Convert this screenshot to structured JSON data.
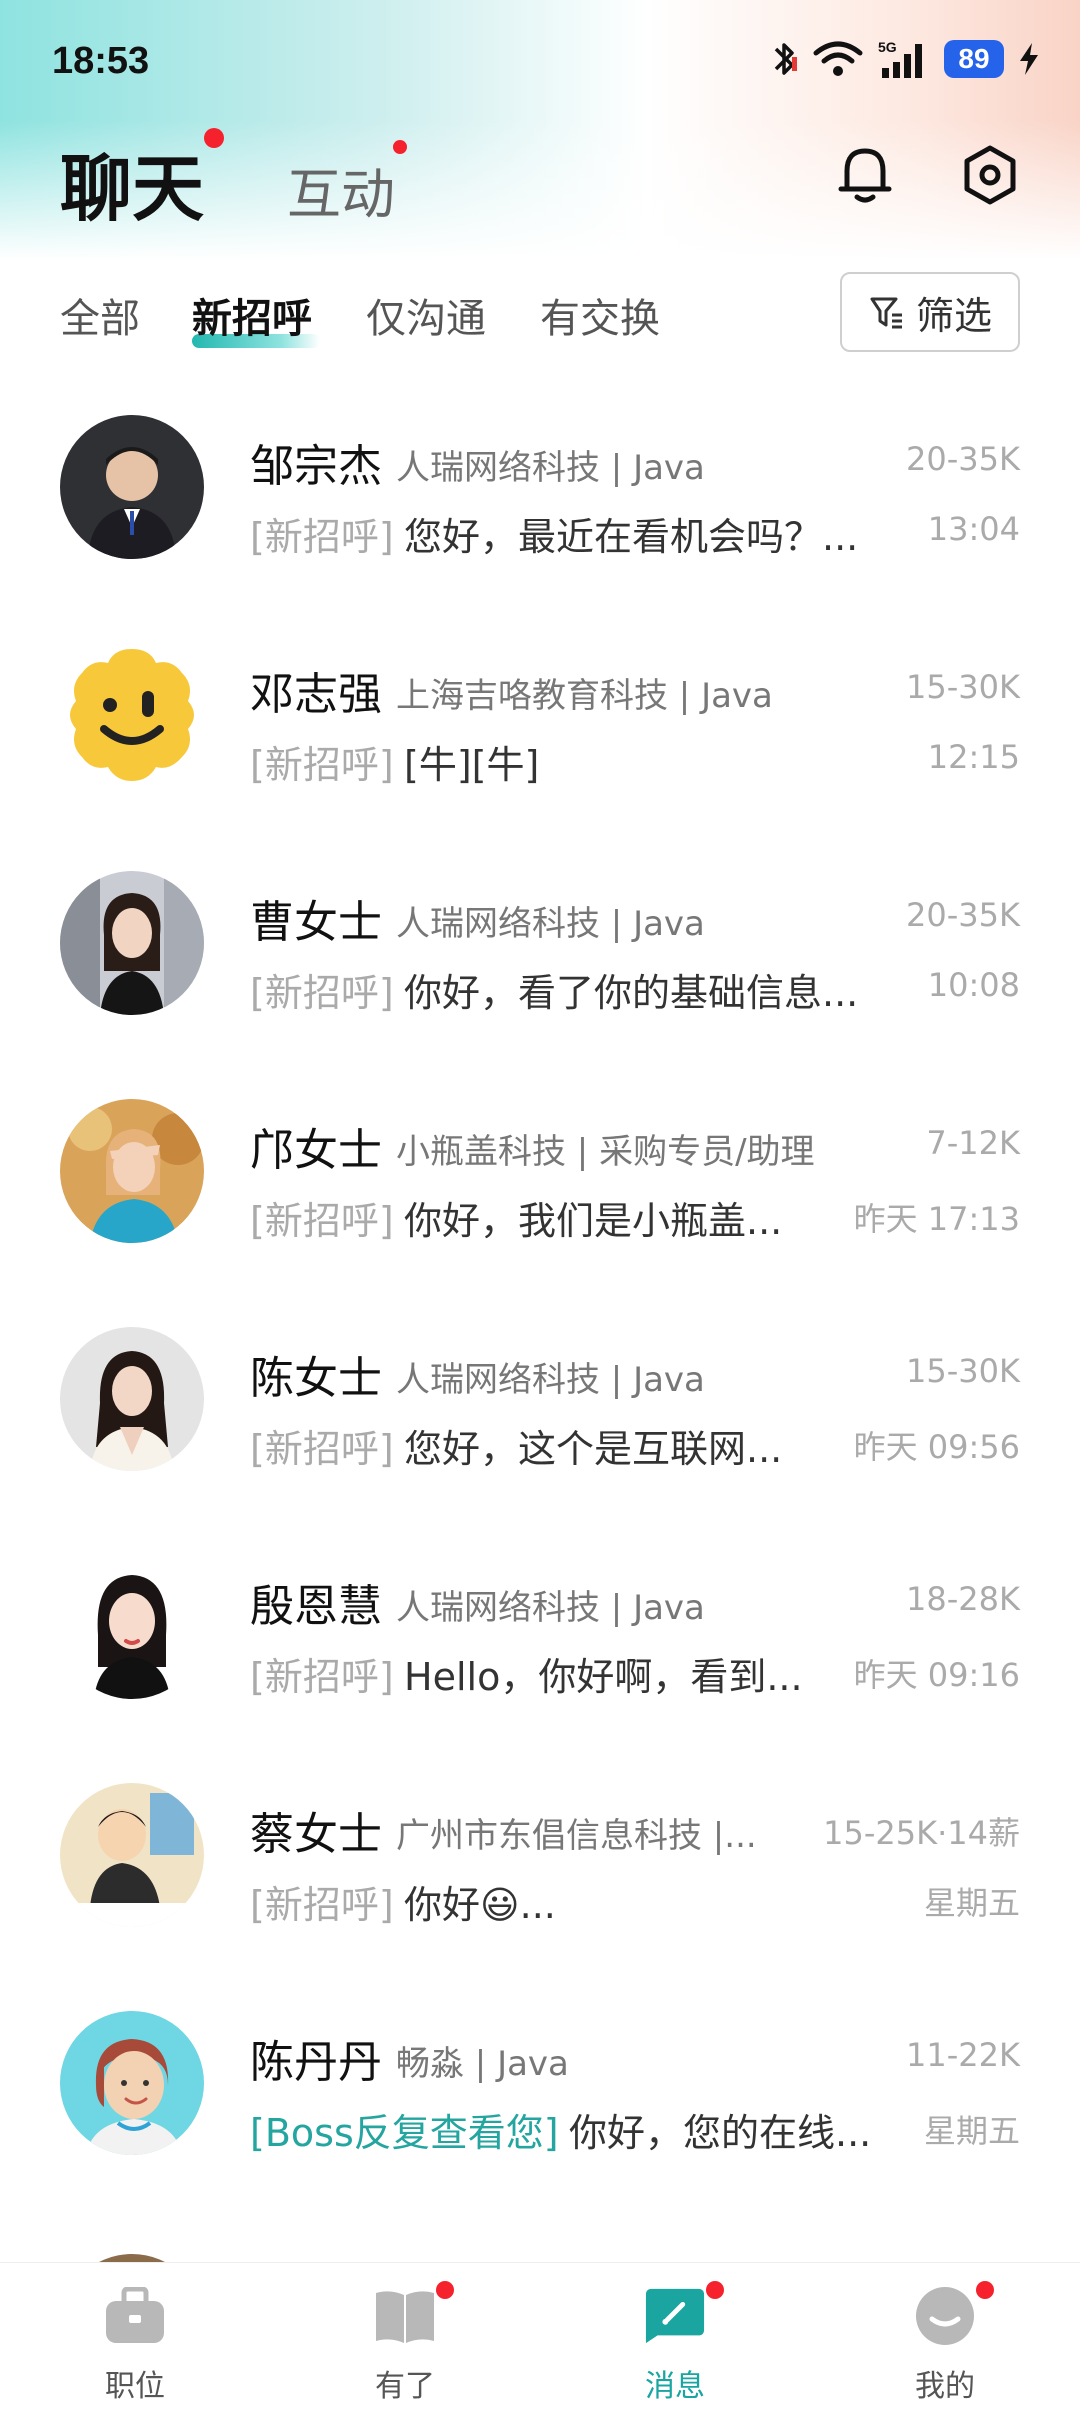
{
  "status_bar": {
    "time": "18:53",
    "battery": "89",
    "network": "5G"
  },
  "header": {
    "tab_chat": "聊天",
    "tab_interact": "互动"
  },
  "filters": {
    "all": "全部",
    "new_greeting": "新招呼",
    "chat_only": "仅沟通",
    "exchanged": "有交换",
    "filter_button": "筛选"
  },
  "chats": [
    {
      "name": "邹宗杰",
      "company": "人瑞网络科技 | Java",
      "salary": "20-35K",
      "tag": "[新招呼]",
      "message": "您好，最近在看机会吗？...",
      "time": "13:04"
    },
    {
      "name": "邓志强",
      "company": "上海吉咯教育科技 | Java",
      "salary": "15-30K",
      "tag": "[新招呼]",
      "message": "[牛][牛]",
      "time": "12:15"
    },
    {
      "name": "曹女士",
      "company": "人瑞网络科技 | Java",
      "salary": "20-35K",
      "tag": "[新招呼]",
      "message": "你好，看了你的基础信息...",
      "time": "10:08"
    },
    {
      "name": "邝女士",
      "company": "小瓶盖科技 | 采购专员/助理",
      "salary": "7-12K",
      "tag": "[新招呼]",
      "message": "你好，我们是小瓶盖...",
      "time": "昨天 17:13"
    },
    {
      "name": "陈女士",
      "company": "人瑞网络科技 | Java",
      "salary": "15-30K",
      "tag": "[新招呼]",
      "message": "您好，这个是互联网...",
      "time": "昨天 09:56"
    },
    {
      "name": "殷恩慧",
      "company": "人瑞网络科技 | Java",
      "salary": "18-28K",
      "tag": "[新招呼]",
      "message": "Hello，你好啊，看到...",
      "time": "昨天 09:16"
    },
    {
      "name": "蔡女士",
      "company": "广州市东倡信息科技 |...",
      "salary": "15-25K·14薪",
      "tag": "[新招呼]",
      "message": "你好😃...",
      "time": "星期五"
    },
    {
      "name": "陈丹丹",
      "company": "畅淼 | Java",
      "salary": "11-22K",
      "tag": "[Boss反复查看您]",
      "message": "你好，您的在线...",
      "time": "星期五"
    }
  ],
  "bottom_nav": {
    "jobs": "职位",
    "youle": "有了",
    "messages": "消息",
    "mine": "我的"
  },
  "colors": {
    "accent": "#1aa5a0",
    "badge": "#f5222d",
    "battery": "#2563eb"
  }
}
